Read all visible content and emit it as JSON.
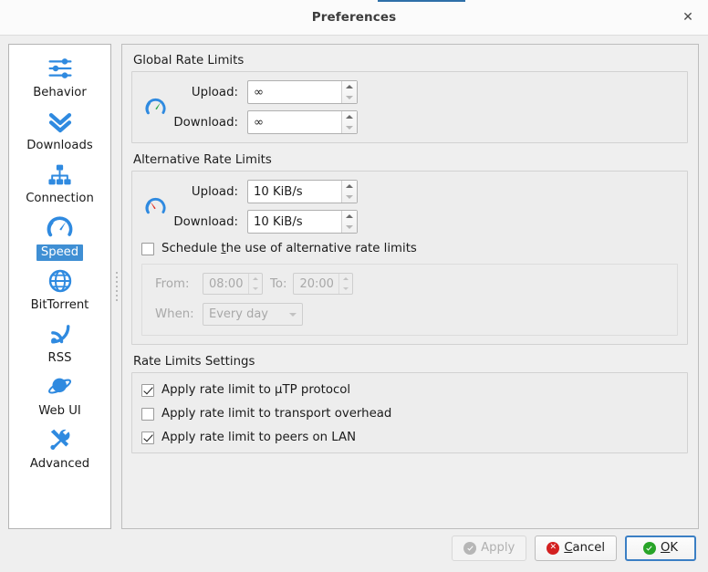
{
  "window": {
    "title": "Preferences",
    "close_label": "✕"
  },
  "sidebar": {
    "items": [
      {
        "label": "Behavior",
        "icon": "sliders-icon",
        "selected": false
      },
      {
        "label": "Downloads",
        "icon": "double-chevron-down-icon",
        "selected": false
      },
      {
        "label": "Connection",
        "icon": "network-tree-icon",
        "selected": false
      },
      {
        "label": "Speed",
        "icon": "speedometer-icon",
        "selected": true
      },
      {
        "label": "BitTorrent",
        "icon": "globe-icon",
        "selected": false
      },
      {
        "label": "RSS",
        "icon": "rss-icon",
        "selected": false
      },
      {
        "label": "Web UI",
        "icon": "planet-icon",
        "selected": false
      },
      {
        "label": "Advanced",
        "icon": "tools-icon",
        "selected": false
      }
    ]
  },
  "global_rate_limits": {
    "title": "Global Rate Limits",
    "upload_label": "Upload:",
    "upload_value": "∞",
    "download_label": "Download:",
    "download_value": "∞",
    "icon": "speedometer-green-icon"
  },
  "alternative_rate_limits": {
    "title": "Alternative Rate Limits",
    "upload_label": "Upload:",
    "upload_value": "10 KiB/s",
    "download_label": "Download:",
    "download_value": "10 KiB/s",
    "icon": "speedometer-red-icon",
    "schedule_checkbox": {
      "checked": false,
      "label_before": "Schedule ",
      "label_mnemonic": "t",
      "label_after": "he use of alternative rate limits"
    },
    "schedule": {
      "enabled": false,
      "from_label": "From:",
      "from_value": "08:00",
      "to_label": "To:",
      "to_value": "20:00",
      "when_label": "When:",
      "when_value": "Every day"
    }
  },
  "rate_limits_settings": {
    "title": "Rate Limits Settings",
    "options": [
      {
        "label": "Apply rate limit to µTP protocol",
        "checked": true
      },
      {
        "label": "Apply rate limit to transport overhead",
        "checked": false
      },
      {
        "label": "Apply rate limit to peers on LAN",
        "checked": true
      }
    ]
  },
  "footer": {
    "apply": {
      "label": "Apply",
      "enabled": false,
      "icon": "check-circle-grey-icon"
    },
    "cancel": {
      "label_before": "",
      "mnemonic": "C",
      "label_after": "ancel",
      "icon": "x-circle-red-icon"
    },
    "ok": {
      "label_before": "",
      "mnemonic": "O",
      "label_after": "K",
      "icon": "check-circle-green-icon",
      "default": true
    }
  },
  "colors": {
    "accent_blue": "#2f8ae0",
    "selection_blue": "#3f8fd4",
    "green": "#28a428",
    "red": "#d32020",
    "window_bg": "#efefef"
  }
}
